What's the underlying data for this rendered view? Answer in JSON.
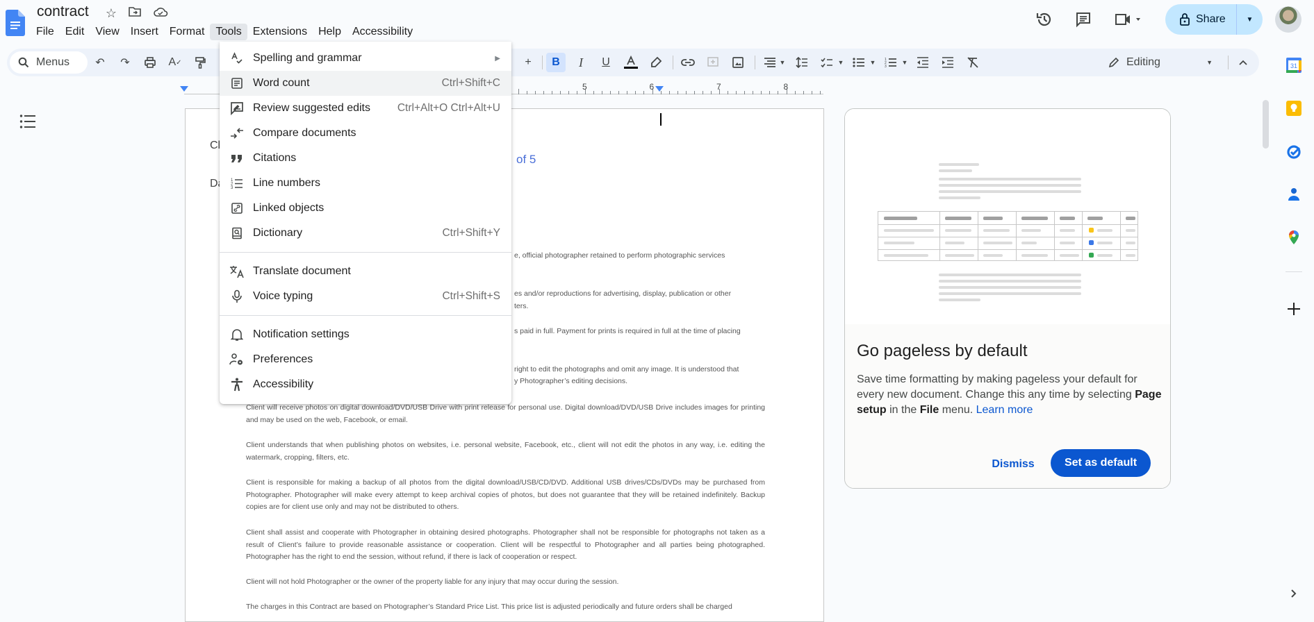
{
  "header": {
    "doc_title": "contract",
    "menus": [
      "File",
      "Edit",
      "View",
      "Insert",
      "Format",
      "Tools",
      "Extensions",
      "Help",
      "Accessibility"
    ],
    "active_menu": "Tools",
    "share_label": "Share"
  },
  "toolbar": {
    "search_menus_label": "Menus",
    "editing_mode": "Editing",
    "bold_active": true
  },
  "ruler": {
    "numbers": [
      "5",
      "6",
      "7",
      "8"
    ]
  },
  "tools_menu": {
    "items": [
      {
        "label": "Spelling and grammar",
        "icon": "spellcheck-icon",
        "submenu": true,
        "shortcut": ""
      },
      {
        "label": "Word count",
        "icon": "word-count-icon",
        "shortcut": "Ctrl+Shift+C",
        "hover": true
      },
      {
        "label": "Review suggested edits",
        "icon": "review-edits-icon",
        "shortcut": "Ctrl+Alt+O Ctrl+Alt+U"
      },
      {
        "label": "Compare documents",
        "icon": "compare-icon",
        "shortcut": ""
      },
      {
        "label": "Citations",
        "icon": "quote-icon",
        "shortcut": ""
      },
      {
        "label": "Line numbers",
        "icon": "line-numbers-icon",
        "shortcut": ""
      },
      {
        "label": "Linked objects",
        "icon": "link-box-icon",
        "shortcut": ""
      },
      {
        "label": "Dictionary",
        "icon": "dictionary-icon",
        "shortcut": "Ctrl+Shift+Y"
      },
      {
        "label": "Translate document",
        "icon": "translate-icon",
        "shortcut": ""
      },
      {
        "label": "Voice typing",
        "icon": "mic-icon",
        "shortcut": "Ctrl+Shift+S"
      },
      {
        "label": "Notification settings",
        "icon": "bell-icon",
        "shortcut": ""
      },
      {
        "label": "Preferences",
        "icon": "preferences-icon",
        "shortcut": ""
      },
      {
        "label": "Accessibility",
        "icon": "accessibility-icon",
        "shortcut": ""
      }
    ]
  },
  "document": {
    "fragment_cl": "Cl",
    "fragment_da": "Da",
    "page_indicator_fragment": "of 5",
    "paragraphs": [
      "e, official photographer retained to perform photographic services",
      "es and/or reproductions for advertising, display, publication or other",
      "ters.",
      "s paid in full. Payment for prints is required in full at the time of  placing",
      "right to edit the photographs and omit any image. It is understood  that",
      "y Photographer’s editing decisions.",
      "Client will receive photos on digital download/DVD/USB Drive with print release for personal use. Digital download/DVD/USB Drive includes  images for printing and may be used on the web, Facebook, or email.",
      "Client understands that when publishing photos on websites, i.e. personal website, Facebook, etc., client will not edit the photos in any way, i.e. editing the watermark, cropping, filters, etc.",
      "Client is responsible for making a backup of all photos from the digital download/USB/CD/DVD. Additional USB drives/CDs/DVDs may be  purchased from Photographer. Photographer will make every attempt to keep archival copies of photos, but does not guarantee that they will be  retained indefinitely. Backup copies are for client use only and may not be distributed to others.",
      "Client shall assist and cooperate with Photographer in obtaining desired photographs. Photographer shall not be responsible for photographs  not taken as a result of Client’s failure to provide reasonable assistance or cooperation. Client will be respectful to Photographer and all parties  being photographed. Photographer has the right to end the session, without refund, if there is lack of cooperation or respect.",
      "Client will not hold Photographer or the owner of the property liable for any injury that may occur during the session.",
      "The charges in this Contract are based on Photographer’s Standard Price List. This price list is adjusted periodically and future orders shall be  charged"
    ]
  },
  "pageless_card": {
    "title": "Go pageless by default",
    "desc_1": "Save time formatting by making pageless your default for every new document. Change this any time by selecting ",
    "desc_bold_1": "Page setup",
    "desc_2": " in the ",
    "desc_bold_2": "File",
    "desc_3": " menu. ",
    "learn_more": "Learn more",
    "dismiss_label": "Dismiss",
    "set_default_label": "Set as default",
    "illustration_colors": [
      "#f9c51a",
      "#3b78e7",
      "#34a853"
    ]
  },
  "side_panel": {
    "apps": [
      "calendar-icon",
      "keep-icon",
      "tasks-icon",
      "contacts-icon",
      "maps-icon"
    ],
    "calendar_day": "31"
  },
  "colors": {
    "accent": "#0b57d0",
    "share_bg": "#c2e7ff",
    "toolbar_bg": "#edf2fa"
  }
}
